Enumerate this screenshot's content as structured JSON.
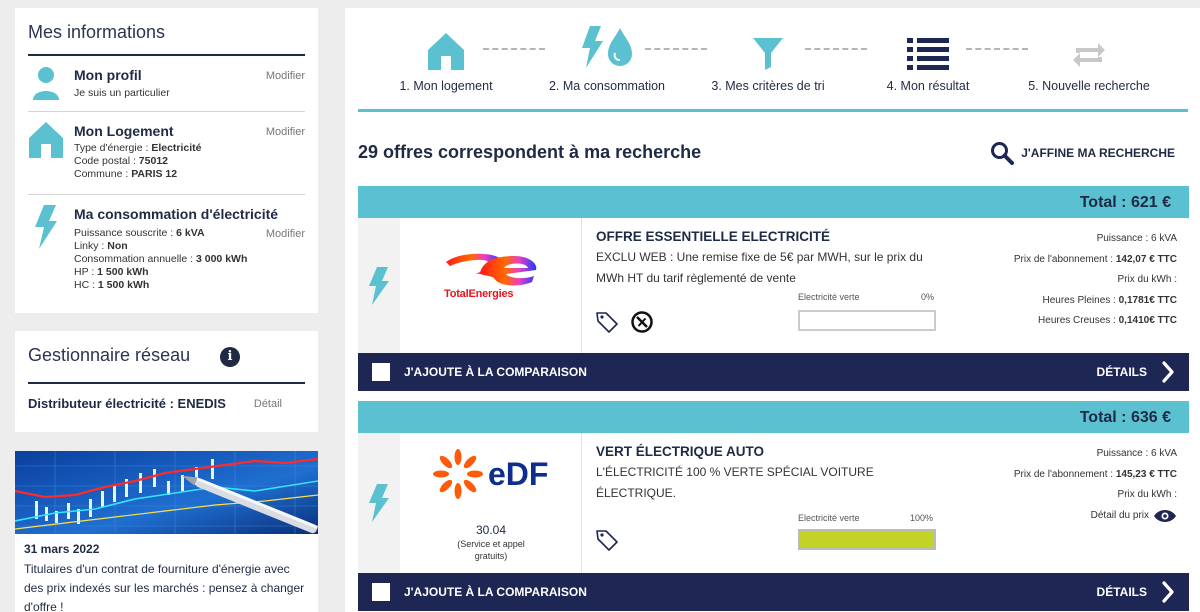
{
  "sidebar": {
    "title": "Mes informations",
    "profil": {
      "title": "Mon profil",
      "modify": "Modifier",
      "text": "Je suis un particulier"
    },
    "logement": {
      "title": "Mon Logement",
      "modify": "Modifier",
      "lines": [
        {
          "label": "Type d'énergie : ",
          "value": "Electricité"
        },
        {
          "label": "Code postal : ",
          "value": "75012"
        },
        {
          "label": "Commune : ",
          "value": "PARIS 12"
        }
      ]
    },
    "consommation": {
      "title": "Ma consommation d'électricité",
      "modify": "Modifier",
      "lines": [
        {
          "label": "Puissance souscrite : ",
          "value": "6 kVA"
        },
        {
          "label": "Linky : ",
          "value": "Non"
        },
        {
          "label": "Consommation annuelle : ",
          "value": "3 000 kWh"
        },
        {
          "label": "HP : ",
          "value": "1 500 kWh"
        },
        {
          "label": "HC : ",
          "value": "1 500 kWh"
        }
      ]
    }
  },
  "reseau": {
    "title": "Gestionnaire réseau",
    "info": "i",
    "distributeur": "Distributeur électricité : ENEDIS",
    "detail": "Détail"
  },
  "news": {
    "date": "31 mars 2022",
    "text": "Titulaires d'un contrat de fourniture d'énergie avec des prix indexés sur les marchés : pensez à changer d'offre !"
  },
  "steps": [
    {
      "label": "1. Mon logement",
      "icon": "house-icon"
    },
    {
      "label": "2. Ma consommation",
      "icon": "bolt-drop-icon"
    },
    {
      "label": "3. Mes critères de tri",
      "icon": "funnel-icon"
    },
    {
      "label": "4. Mon résultat",
      "icon": "list-icon"
    },
    {
      "label": "5. Nouvelle recherche",
      "icon": "repeat-icon"
    }
  ],
  "results": {
    "title": "29 offres correspondent à ma recherche",
    "refine": "J'AFFINE MA RECHERCHE"
  },
  "offers": [
    {
      "total": "Total : 621 €",
      "brand": "TotalEnergies",
      "name": "OFFRE ESSENTIELLE ELECTRICITÉ",
      "desc": "EXCLU WEB : Une remise fixe de 5€ par MWH, sur le prix du MWh HT du tarif règlementé de vente",
      "green_label": "Electricité verte",
      "green_pct": "0%",
      "green_value": 0,
      "puissance": "Puissance : 6 kVA",
      "abo_label": "Prix de l'abonnement : ",
      "abo_value": "142,07 € TTC",
      "prix_kwh": "Prix du kWh :",
      "hp_label": "Heures Pleines : ",
      "hp_value": "0,1781€ TTC",
      "hc_label": "Heures Creuses : ",
      "hc_value": "0,1410€ TTC",
      "compare": "J'AJOUTE À LA COMPARAISON",
      "details": "DÉTAILS"
    },
    {
      "total": "Total : 636 €",
      "brand": "eDF",
      "score": "30.04",
      "score_note": "(Service et appel gratuits)",
      "name": "VERT ÉLECTRIQUE AUTO",
      "desc": "L'ÉLECTRICITÉ 100 % VERTE SPÉCIAL VOITURE ÉLECTRIQUE.",
      "green_label": "Electricité verte",
      "green_pct": "100%",
      "green_value": 100,
      "puissance": "Puissance : 6 kVA",
      "abo_label": "Prix de l'abonnement : ",
      "abo_value": "145,23 € TTC",
      "prix_kwh": "Prix du kWh :",
      "detail_prix": "Détail du prix",
      "compare": "J'AJOUTE À LA COMPARAISON",
      "details": "DÉTAILS"
    }
  ],
  "colors": {
    "accent": "#5bc0cf",
    "navy": "#1e2654",
    "green": "#c2d227"
  }
}
